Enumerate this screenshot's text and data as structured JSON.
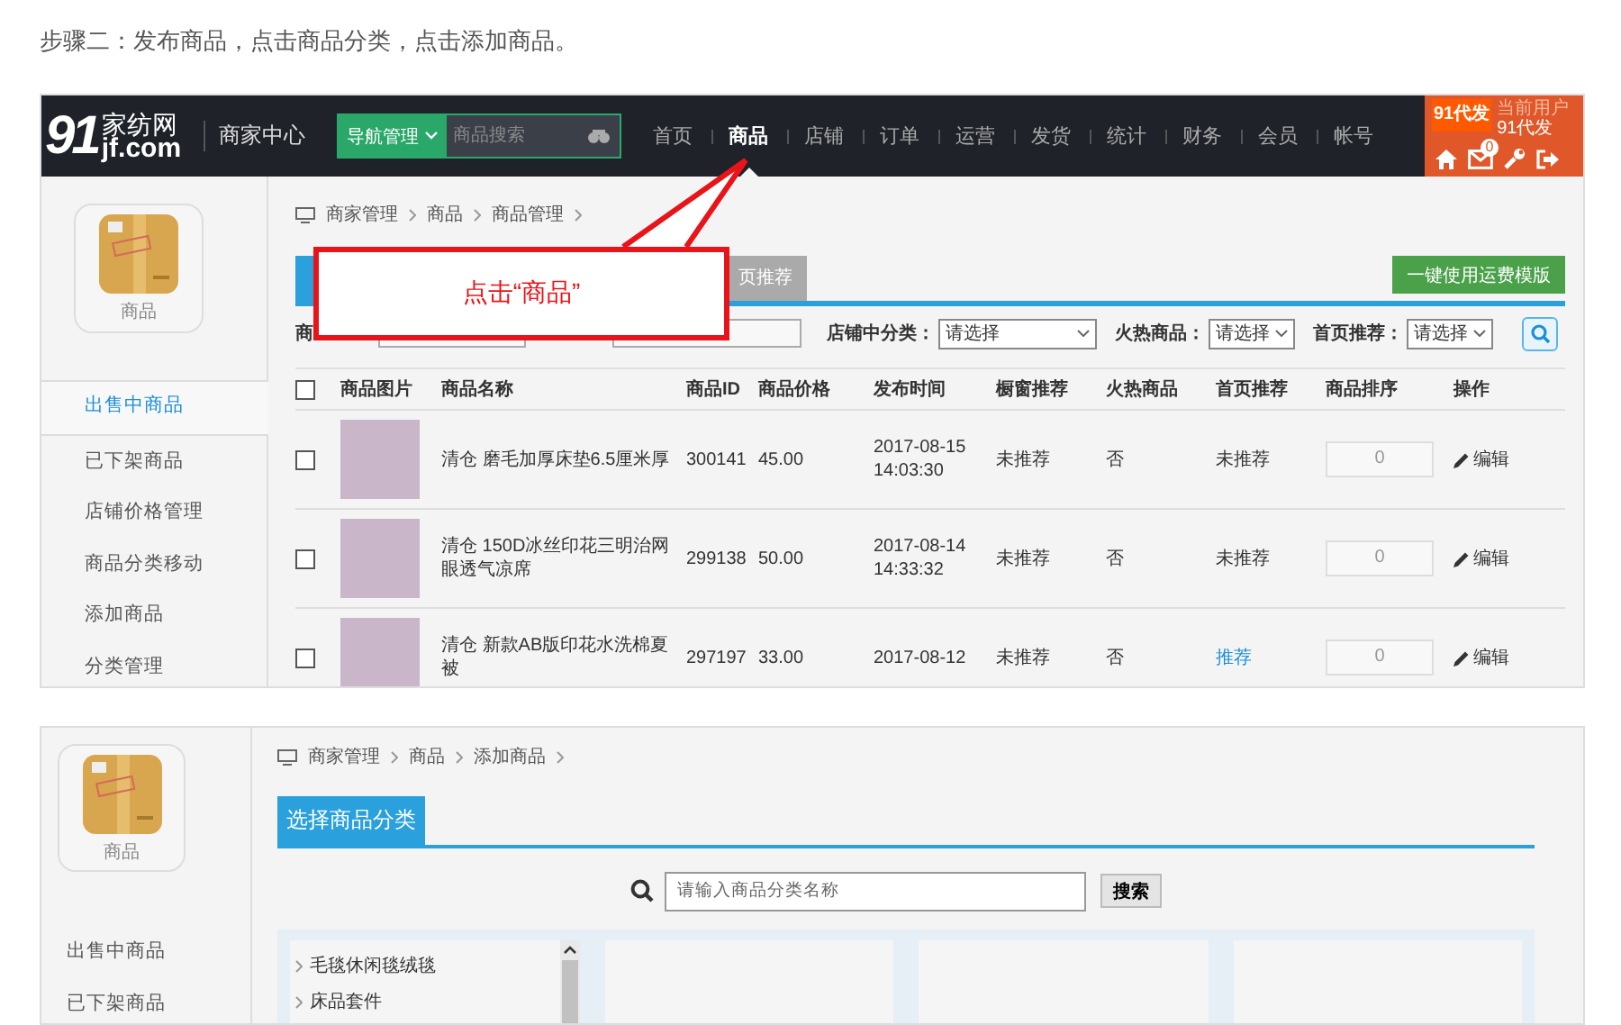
{
  "heading": "步骤二：发布商品，点击商品分类，点击添加商品。",
  "screenshot_1": {
    "top_bar": {
      "logo_number": "91",
      "logo_name": "家纺网",
      "logo_domain": "jf.com",
      "center_title": "商家中心",
      "nav_dropdown": "导航管理",
      "search": {
        "placeholder": "商品搜索"
      },
      "nav_items": [
        {
          "label": "首页",
          "selected": false
        },
        {
          "label": "商品",
          "selected": true
        },
        {
          "label": "店铺",
          "selected": false
        },
        {
          "label": "订单",
          "selected": false
        },
        {
          "label": "运营",
          "selected": false
        },
        {
          "label": "发货",
          "selected": false
        },
        {
          "label": "统计",
          "selected": false
        },
        {
          "label": "财务",
          "selected": false
        },
        {
          "label": "会员",
          "selected": false
        },
        {
          "label": "帐号",
          "selected": false
        }
      ],
      "user_panel": {
        "badge": "91代发",
        "label": "当前用户",
        "name": "91代发",
        "mail_count": "0"
      }
    },
    "sidebar": {
      "card_label": "商品",
      "items": [
        {
          "label": "出售中商品",
          "selected": true
        },
        {
          "label": "已下架商品",
          "selected": false
        },
        {
          "label": "店铺价格管理",
          "selected": false
        },
        {
          "label": "商品分类移动",
          "selected": false
        },
        {
          "label": "添加商品",
          "selected": false
        },
        {
          "label": "分类管理",
          "selected": false
        }
      ]
    },
    "breadcrumb": [
      "商家管理",
      "商品",
      "商品管理"
    ],
    "tabs": [
      {
        "selected": true
      },
      {
        "label": "页推荐",
        "selected": false
      }
    ],
    "template_button": "一键使用运费模版",
    "filters": {
      "partial_label": "商",
      "selects": [
        {
          "label": "店铺中分类：",
          "value": "请选择"
        },
        {
          "label": "火热商品：",
          "value": "请选择"
        },
        {
          "label": "首页推荐：",
          "value": "请选择"
        }
      ]
    },
    "table": {
      "header_checked": false,
      "columns": [
        "商品图片",
        "商品名称",
        "商品ID",
        "商品价格",
        "发布时间",
        "橱窗推荐",
        "火热商品",
        "首页推荐",
        "商品排序",
        "操作"
      ],
      "rows": [
        {
          "checked": false,
          "name": "清仓 磨毛加厚床垫6.5厘米厚",
          "id": "300141",
          "price": "45.00",
          "date": "2017-08-15",
          "time": "14:03:30",
          "window": "未推荐",
          "hot": "否",
          "home": "未推荐",
          "home_recommended": false,
          "sort": "0",
          "action": "编辑"
        },
        {
          "checked": false,
          "name": "清仓 150D冰丝印花三明治网眼透气凉席",
          "id": "299138",
          "price": "50.00",
          "date": "2017-08-14",
          "time": "14:33:32",
          "window": "未推荐",
          "hot": "否",
          "home": "未推荐",
          "home_recommended": false,
          "sort": "0",
          "action": "编辑"
        },
        {
          "checked": false,
          "name": "清仓 新款AB版印花水洗棉夏被",
          "id": "297197",
          "price": "33.00",
          "date": "2017-08-12",
          "window": "未推荐",
          "hot": "否",
          "home": "推荐",
          "home_recommended": true,
          "sort": "0",
          "action": "编辑"
        }
      ]
    },
    "callout": "点击“商品”"
  },
  "screenshot_2": {
    "sidebar": {
      "card_label": "商品",
      "items": [
        "出售中商品",
        "已下架商品"
      ]
    },
    "breadcrumb": [
      "商家管理",
      "商品",
      "添加商品"
    ],
    "tab": "选择商品分类",
    "search": {
      "placeholder": "请输入商品分类名称",
      "button": "搜索"
    },
    "category_list": [
      "毛毯休闲毯绒毯",
      "床品套件"
    ]
  }
}
